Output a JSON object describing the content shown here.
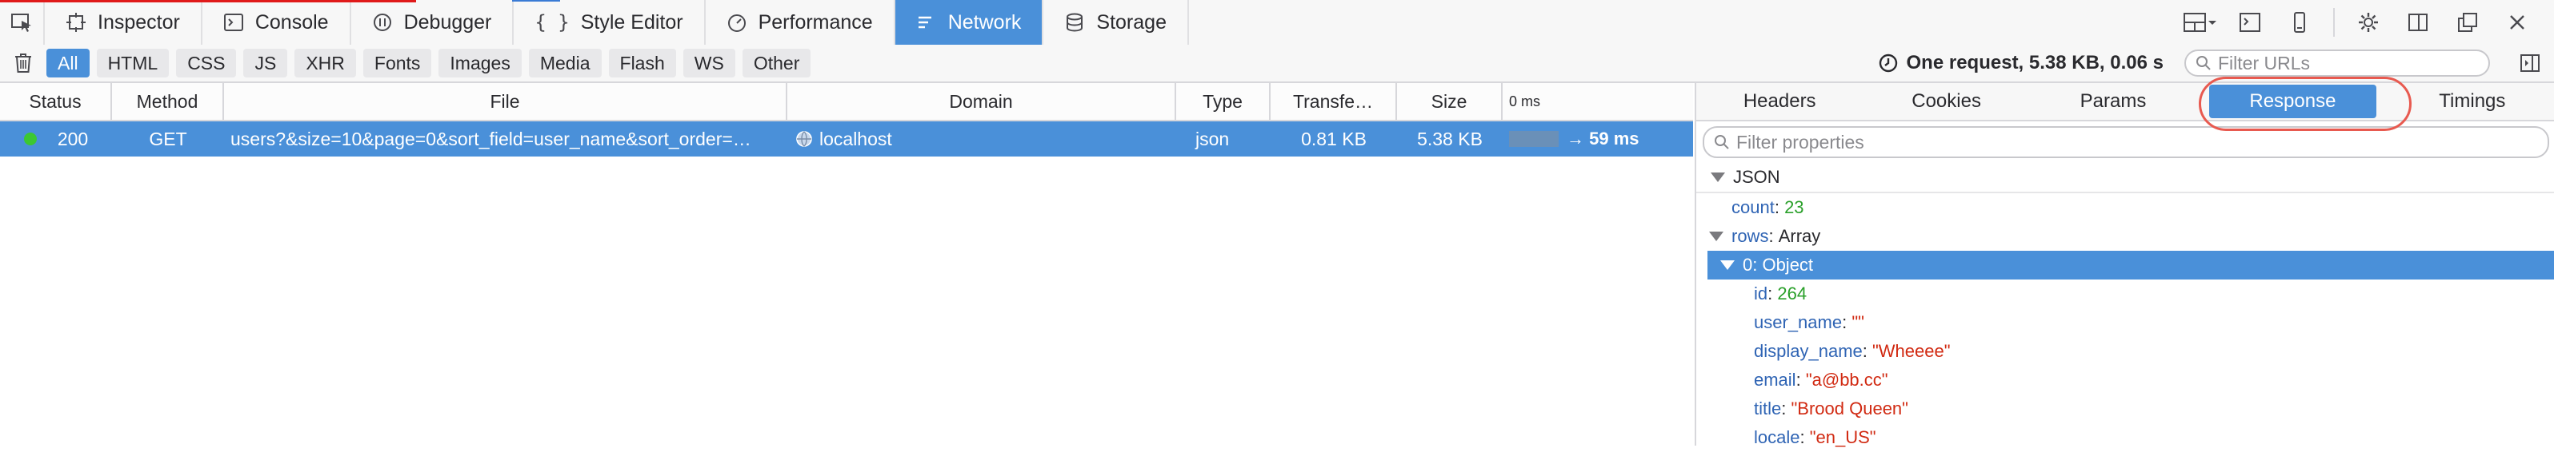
{
  "toolbar": {
    "tabs": [
      {
        "label": "Inspector",
        "icon": "inspector-icon"
      },
      {
        "label": "Console",
        "icon": "console-icon"
      },
      {
        "label": "Debugger",
        "icon": "debugger-icon"
      },
      {
        "label": "Style Editor",
        "icon": "style-editor-icon"
      },
      {
        "label": "Performance",
        "icon": "performance-icon"
      },
      {
        "label": "Network",
        "icon": "network-icon",
        "selected": true
      },
      {
        "label": "Storage",
        "icon": "storage-icon"
      }
    ]
  },
  "filterbar": {
    "buttons": [
      "All",
      "HTML",
      "CSS",
      "JS",
      "XHR",
      "Fonts",
      "Images",
      "Media",
      "Flash",
      "WS",
      "Other"
    ],
    "active": "All",
    "summary": "One request, 5.38 KB, 0.06 s",
    "url_filter_placeholder": "Filter URLs"
  },
  "list": {
    "columns": [
      "Status",
      "Method",
      "File",
      "Domain",
      "Type",
      "Transfe…",
      "Size",
      "0 ms"
    ],
    "rows": [
      {
        "status": "200",
        "method": "GET",
        "file": "users?&size=10&page=0&sort_field=user_name&sort_order=…",
        "domain": "localhost",
        "type": "json",
        "transferred": "0.81 KB",
        "size": "5.38 KB",
        "timing": "→ 59 ms"
      }
    ]
  },
  "sidebar": {
    "tabs": [
      "Headers",
      "Cookies",
      "Params",
      "Response",
      "Timings"
    ],
    "selected_tab": "Response",
    "filter_placeholder": "Filter properties",
    "json_header": "JSON",
    "count": {
      "key": "count",
      "value": "23"
    },
    "rows_line": {
      "key": "rows",
      "value": "Array"
    },
    "object_line": "0: Object",
    "fields": [
      {
        "key": "id",
        "value": "264",
        "kind": "num"
      },
      {
        "key": "user_name",
        "value": "\"\"",
        "kind": "str"
      },
      {
        "key": "display_name",
        "value": "\"Wheeee\"",
        "kind": "str"
      },
      {
        "key": "email",
        "value": "\"a@bb.cc\"",
        "kind": "str"
      },
      {
        "key": "title",
        "value": "\"Brood Queen\"",
        "kind": "str"
      },
      {
        "key": "locale",
        "value": "\"en_US\"",
        "kind": "str"
      }
    ]
  },
  "colors": {
    "accent": "#4a90d9",
    "status_ok": "#3cc832",
    "annotation": "#e85a50"
  }
}
